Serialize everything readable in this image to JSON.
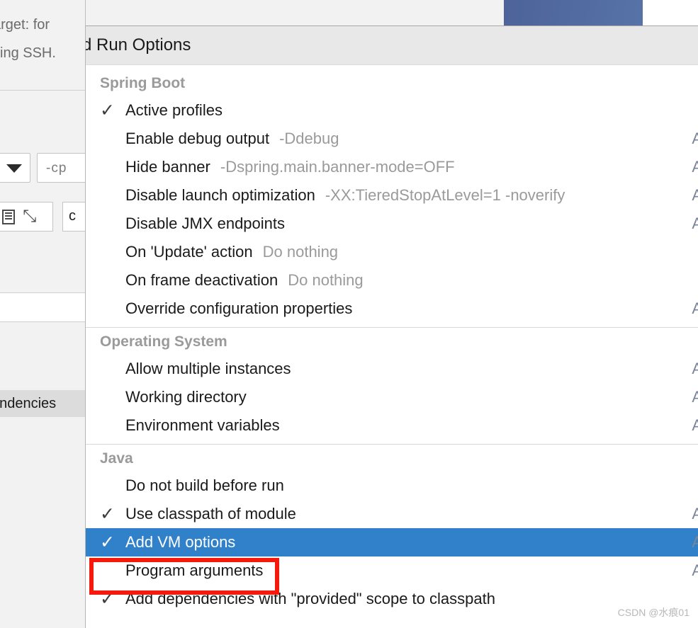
{
  "background": {
    "description_lines": [
      "arget: for",
      "sing SSH."
    ],
    "classpath_field_value": "-cp",
    "dropdown_icon": "chevron-down-icon",
    "toolbar_icons": [
      "lines-icon",
      "expand-icon"
    ],
    "char_button_label": "c",
    "selected_tree_row": "endencies",
    "blue_button_label": ""
  },
  "popup": {
    "title": "Add Run Options",
    "sections": [
      {
        "name": "Spring Boot",
        "items": [
          {
            "checked": true,
            "label": "Active profiles",
            "hint": "",
            "shortcut": ""
          },
          {
            "checked": false,
            "label": "Enable debug output",
            "hint": "-Ddebug",
            "shortcut": "A"
          },
          {
            "checked": false,
            "label": "Hide banner",
            "hint": "-Dspring.main.banner-mode=OFF",
            "shortcut": "A"
          },
          {
            "checked": false,
            "label": "Disable launch optimization",
            "hint": "-XX:TieredStopAtLevel=1 -noverify",
            "shortcut": "A"
          },
          {
            "checked": false,
            "label": "Disable JMX endpoints",
            "hint": "",
            "shortcut": "A"
          },
          {
            "checked": false,
            "label": "On 'Update' action",
            "hint": "Do nothing",
            "shortcut": ""
          },
          {
            "checked": false,
            "label": "On frame deactivation",
            "hint": "Do nothing",
            "shortcut": ""
          },
          {
            "checked": false,
            "label": "Override configuration properties",
            "hint": "",
            "shortcut": "A"
          }
        ]
      },
      {
        "name": "Operating System",
        "items": [
          {
            "checked": false,
            "label": "Allow multiple instances",
            "hint": "",
            "shortcut": "A"
          },
          {
            "checked": false,
            "label": "Working directory",
            "hint": "",
            "shortcut": "A"
          },
          {
            "checked": false,
            "label": "Environment variables",
            "hint": "",
            "shortcut": "A"
          }
        ]
      },
      {
        "name": "Java",
        "items": [
          {
            "checked": false,
            "label": "Do not build before run",
            "hint": "",
            "shortcut": ""
          },
          {
            "checked": true,
            "label": "Use classpath of module",
            "hint": "",
            "shortcut": "A"
          },
          {
            "checked": true,
            "label": "Add VM options",
            "hint": "",
            "shortcut": "A",
            "selected": true
          },
          {
            "checked": false,
            "label": "Program arguments",
            "hint": "",
            "shortcut": "A"
          },
          {
            "checked": true,
            "label": "Add dependencies with \"provided\" scope to classpath",
            "hint": "",
            "shortcut": ""
          }
        ]
      }
    ]
  },
  "annotation": {
    "shape": "rectangle",
    "color": "#f61a0c",
    "target": "Add VM options"
  },
  "watermark": {
    "text": "CSDN @水痕01"
  },
  "colors": {
    "selection_blue": "#3081c9",
    "annotation_red": "#f61a0c",
    "title_bar": "#e8e8e8",
    "section_header": "#9a9a9a",
    "bg_button_blue": "#51689f"
  },
  "icons": {
    "check": "✓"
  }
}
